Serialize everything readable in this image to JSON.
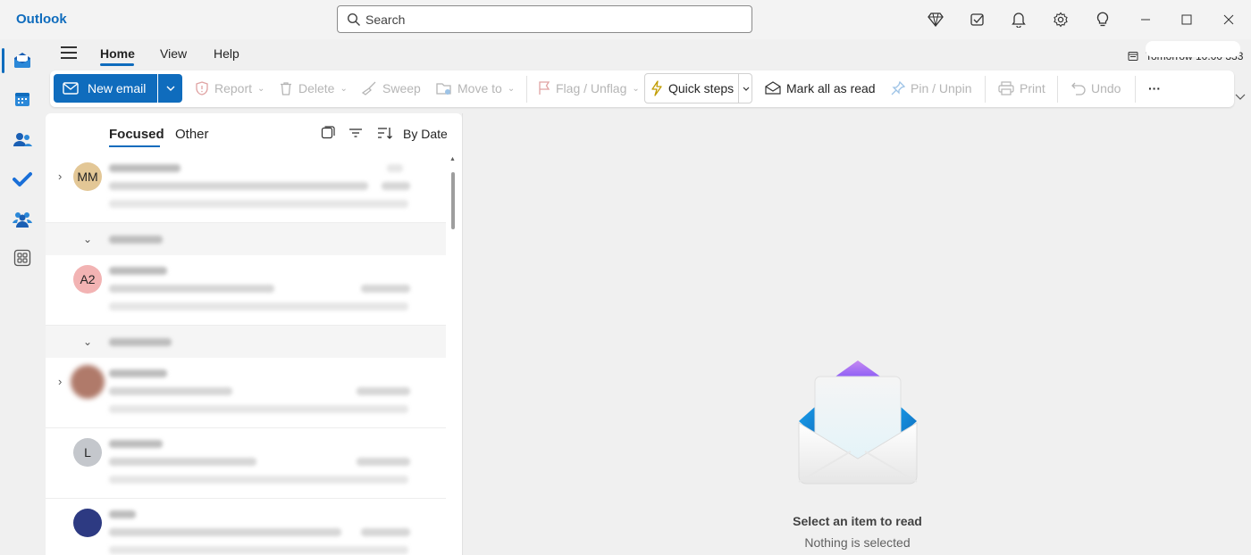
{
  "app": {
    "title": "Outlook"
  },
  "search": {
    "placeholder": "Search"
  },
  "titlebar_icons": [
    "premium-diamond-icon",
    "my-day-icon",
    "bell-icon",
    "gear-icon",
    "lightbulb-icon"
  ],
  "window_controls": [
    "minimize-icon",
    "maximize-icon",
    "close-icon"
  ],
  "rail": {
    "items": [
      "mail",
      "calendar",
      "people",
      "to-do",
      "teams",
      "apps"
    ],
    "active": "mail"
  },
  "tabs": [
    {
      "label": "Home",
      "active": true
    },
    {
      "label": "View",
      "active": false
    },
    {
      "label": "Help",
      "active": false
    }
  ],
  "reminder": {
    "text": "Tomorrow 10:00 333"
  },
  "ribbon": {
    "new_email": "New email",
    "report": "Report",
    "delete": "Delete",
    "sweep": "Sweep",
    "move_to": "Move to",
    "flag": "Flag / Unflag",
    "quick_steps": "Quick steps",
    "mark_all_read": "Mark all as read",
    "pin": "Pin / Unpin",
    "print": "Print",
    "undo": "Undo",
    "more": "···"
  },
  "list": {
    "pivot_focused": "Focused",
    "pivot_other": "Other",
    "sort": "By Date",
    "groups": [
      "Yesterday",
      "This month"
    ],
    "items": [
      {
        "avatar_text": "MM",
        "avatar_color": "#e3c796"
      },
      {
        "avatar_text": "A2",
        "avatar_color": "#f2b3b3"
      },
      {
        "avatar_text": "",
        "avatar_color": "#b07a6a"
      },
      {
        "avatar_text": "L",
        "avatar_color": "#c4c7cc"
      },
      {
        "avatar_text": "",
        "avatar_color": "#2d3a82"
      }
    ]
  },
  "reading": {
    "title": "Select an item to read",
    "subtitle": "Nothing is selected"
  },
  "colors": {
    "accent": "#0f6cbd",
    "background": "#f0f0f0"
  }
}
